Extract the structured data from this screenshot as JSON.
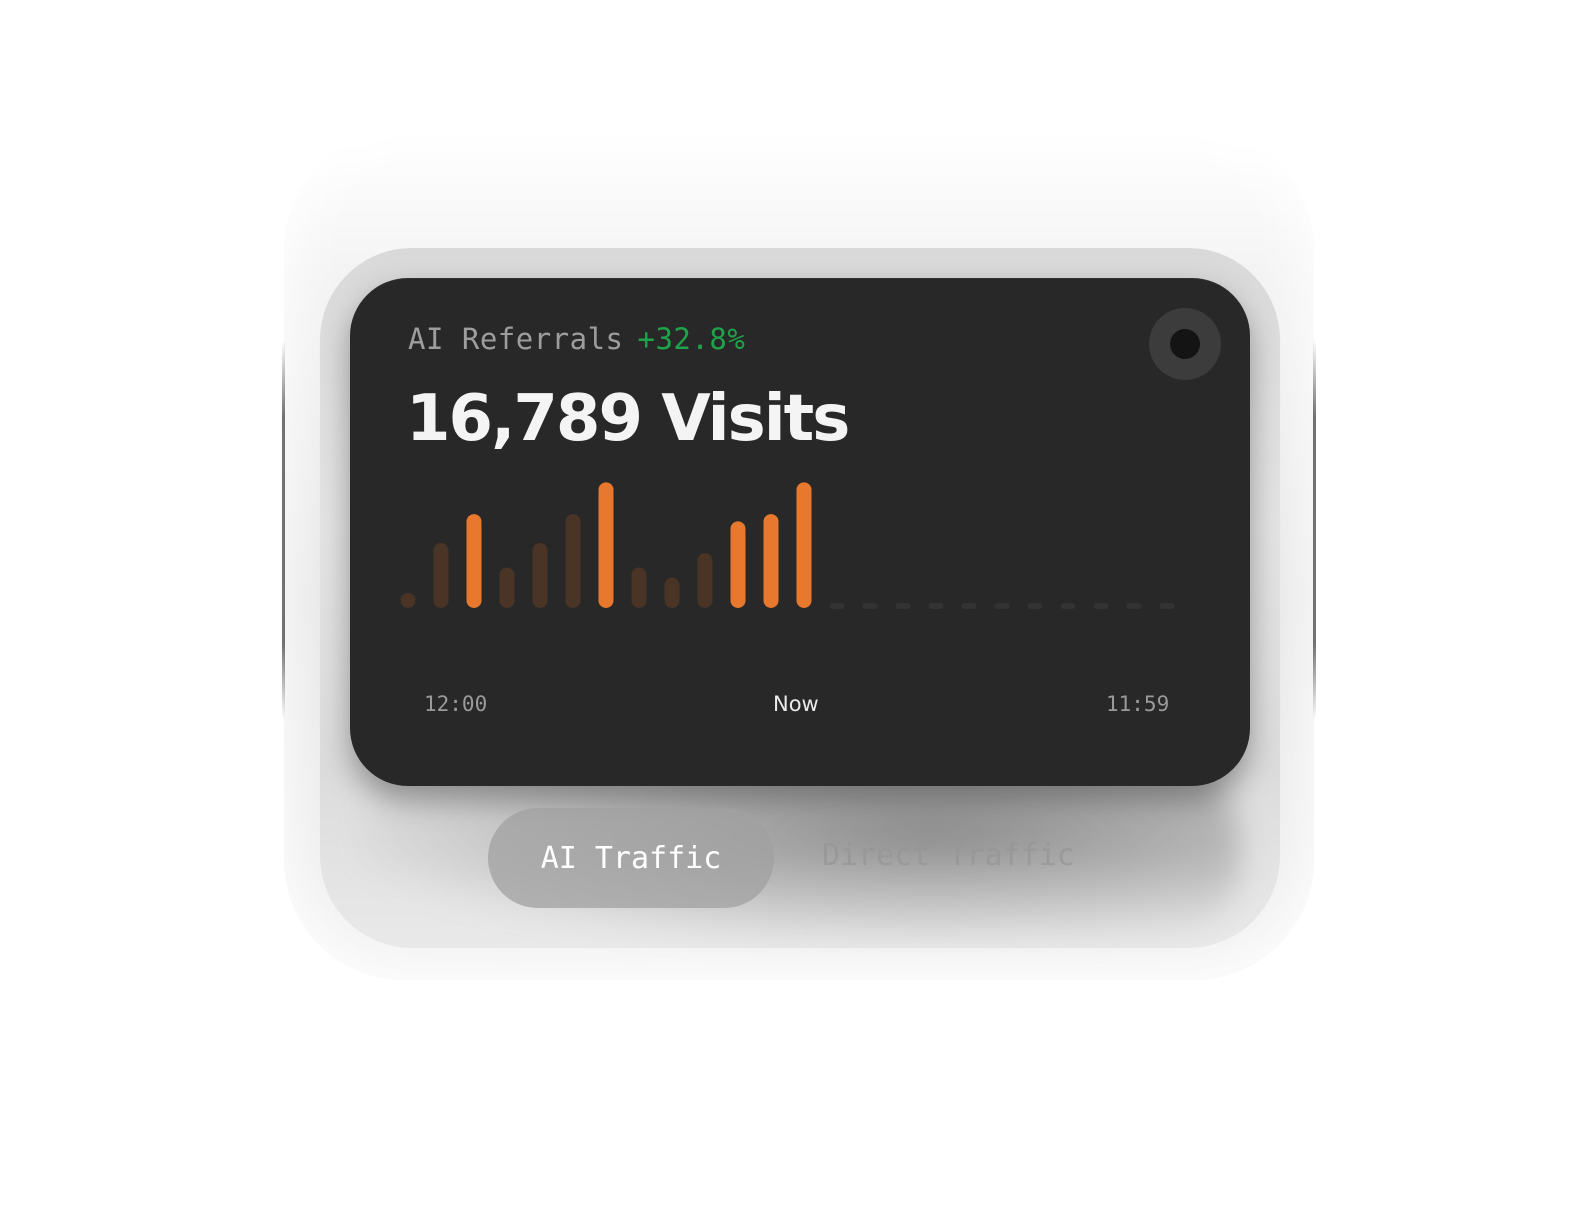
{
  "widget": {
    "label": "AI Referrals",
    "delta": "+32.8%",
    "headline": "16,789 Visits",
    "colors": {
      "card": "#282828",
      "accent": "#e8782e",
      "dim_bar": "#4a3426",
      "future_tick": "#333333",
      "delta": "#1fa34a"
    }
  },
  "chart_data": {
    "type": "bar",
    "categories": [],
    "series": [
      {
        "values": [
          1,
          4.5,
          6.5,
          2.8,
          4.5,
          6.5,
          8.7,
          2.8,
          2.1,
          3.8,
          6,
          6.5,
          8.7
        ],
        "highlighted": [
          false,
          false,
          true,
          false,
          false,
          false,
          true,
          false,
          false,
          false,
          true,
          true,
          true
        ]
      }
    ],
    "future_slots": 11,
    "ylim": [
      0,
      9
    ],
    "xlabel": "",
    "ylabel": "",
    "title": ""
  },
  "timeline": {
    "start": "12:00",
    "current": "Now",
    "end": "11:59"
  },
  "tabs": [
    {
      "label": "AI Traffic",
      "active": true
    },
    {
      "label": "Direct Traffic",
      "active": false
    }
  ],
  "icons": {
    "camera": "camera-icon"
  }
}
